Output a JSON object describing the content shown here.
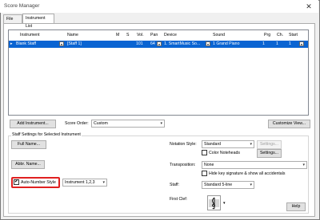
{
  "window": {
    "title": "Score Manager",
    "close_glyph": "✕"
  },
  "tabs": [
    {
      "label": "File Info"
    },
    {
      "label": "Instrument List"
    }
  ],
  "table": {
    "headers": [
      "Instrument",
      "Name",
      "M",
      "S",
      "Vol.",
      "Pan",
      "Device",
      "Sound",
      "Prg",
      "Ch.",
      "Start"
    ],
    "row": {
      "instrument": "Blank Staff",
      "name": "[Staff 1]",
      "vol": "101",
      "pan": "64",
      "device": "1. SmartMusic So...",
      "sound": "1 Grand Piano",
      "prg": "1",
      "ch": "1",
      "start": "1"
    },
    "row_marker": "▸"
  },
  "toolbar": {
    "add_instrument": "Add Instrument...",
    "score_order_label": "Score Order:",
    "score_order_value": "Custom",
    "customize_view": "Customize View..."
  },
  "staff_settings": {
    "group_title": "Staff Settings for Selected Instrument",
    "full_name": "Full Name...",
    "abbr_name": "Abbr. Name...",
    "auto_number_label": "Auto-Number Style",
    "auto_number_checked": true,
    "auto_number_value": "Instrument 1,2,3",
    "notation_style_label": "Notation Style:",
    "notation_style_value": "Standard",
    "settings_disabled": "Settings...",
    "color_noteheads_label": "Color Noteheads",
    "settings_button": "Settings...",
    "transposition_label": "Transposition:",
    "transposition_value": "None",
    "hide_key_label": "Hide key signature & show all accidentals",
    "staff_label": "Staff:",
    "staff_value": "Standard 5-line",
    "first_clef_label": "First Clef:"
  },
  "help_button": "Help",
  "icons": {
    "dropdown": "chevron-down-icon",
    "check": "✔",
    "clef": "treble-clef-icon"
  }
}
